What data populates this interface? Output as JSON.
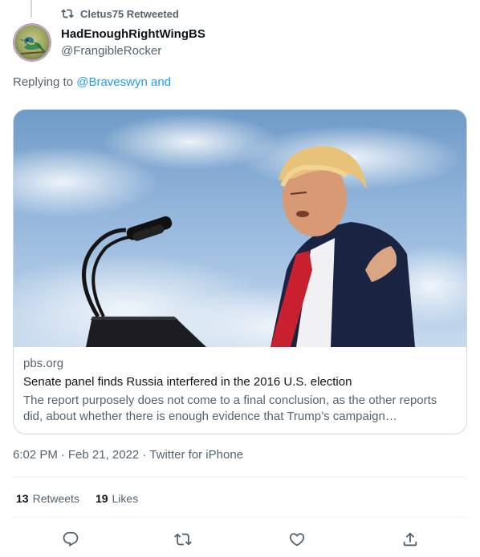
{
  "retweet": {
    "text": "Cletus75 Retweeted",
    "icon": "retweet-icon"
  },
  "author": {
    "display_name": "HadEnoughRightWingBS",
    "handle": "@FrangibleRocker"
  },
  "reply": {
    "prefix": "Replying to ",
    "mention": "@Braveswyn and"
  },
  "card": {
    "domain": "pbs.org",
    "title": "Senate panel finds Russia interfered in the 2016 U.S. election",
    "description": "The report purposely does not come to a final conclusion, as the other reports did, about whether there is enough evidence that Trump’s campaign coordinated…"
  },
  "meta": {
    "time": "6:02 PM",
    "sep1": "·",
    "date": "Feb 21, 2022",
    "sep2": "·",
    "source": "Twitter for iPhone"
  },
  "stats": {
    "retweets_count": "13",
    "retweets_label": "Retweets",
    "likes_count": "19",
    "likes_label": "Likes"
  },
  "actions": [
    "reply-icon",
    "retweet-icon",
    "like-icon",
    "share-icon"
  ],
  "colors": {
    "accent": "#1d9bf0",
    "secondary_text": "#536471",
    "border": "#cfd9de"
  }
}
